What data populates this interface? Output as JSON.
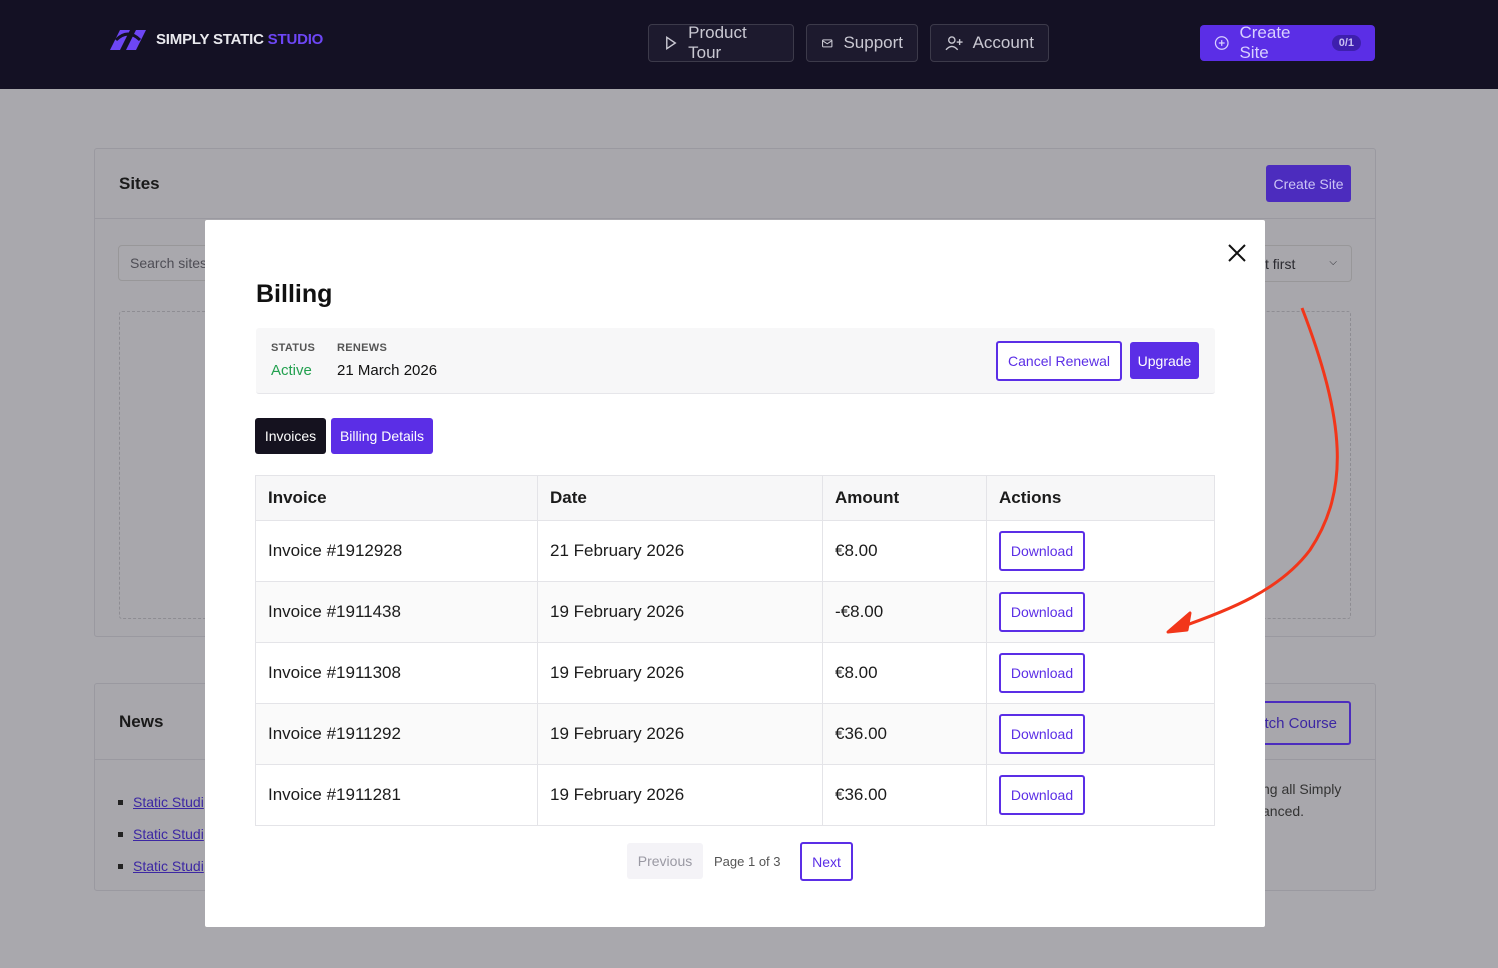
{
  "nav": {
    "logo_main": "SIMPLY STATIC",
    "logo_accent": "STUDIO",
    "product_tour": "Product Tour",
    "support": "Support",
    "account": "Account",
    "create_site": "Create Site",
    "create_site_badge": "0/1"
  },
  "sites_card": {
    "title": "Sites",
    "create_button": "Create Site",
    "search_placeholder": "Search sites...",
    "sort_value": "t first"
  },
  "news_card": {
    "title": "News",
    "items": [
      "Static Studi",
      "Static Studi",
      "Static Studi"
    ],
    "watch_button": "tch Course",
    "text_line1": "ng all Simply",
    "text_line2": "anced."
  },
  "modal": {
    "title": "Billing",
    "status_label": "STATUS",
    "status_value": "Active",
    "renews_label": "RENEWS",
    "renews_value": "21 March 2026",
    "cancel_renewal": "Cancel Renewal",
    "upgrade": "Upgrade",
    "tabs": [
      "Invoices",
      "Billing Details"
    ],
    "columns": [
      "Invoice",
      "Date",
      "Amount",
      "Actions"
    ],
    "rows": [
      {
        "invoice": "Invoice #1912928",
        "date": "21 February 2026",
        "amount": "€8.00",
        "action": "Download"
      },
      {
        "invoice": "Invoice #1911438",
        "date": "19 February 2026",
        "amount": "-€8.00",
        "action": "Download"
      },
      {
        "invoice": "Invoice #1911308",
        "date": "19 February 2026",
        "amount": "€8.00",
        "action": "Download"
      },
      {
        "invoice": "Invoice #1911292",
        "date": "19 February 2026",
        "amount": "€36.00",
        "action": "Download"
      },
      {
        "invoice": "Invoice #1911281",
        "date": "19 February 2026",
        "amount": "€36.00",
        "action": "Download"
      }
    ],
    "pagination": {
      "previous": "Previous",
      "page_info": "Page 1 of 3",
      "next": "Next"
    }
  },
  "colors": {
    "nav_bg": "#141124",
    "brand_purple": "#5b2ee6",
    "active_green": "#22a04f",
    "annotation_red": "#f2361a"
  },
  "icons": [
    "play-icon",
    "mail-icon",
    "user-plus-icon",
    "plus-circle-icon",
    "close-icon",
    "chevron-down-icon"
  ]
}
